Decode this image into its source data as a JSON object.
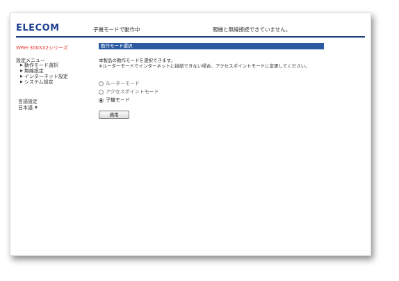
{
  "header": {
    "logo": "ELECOM",
    "status_mode": "子機モードで動作中",
    "status_link": "親機と無線接続できていません。"
  },
  "sidebar": {
    "model": "WRH-300XX2シリーズ",
    "menu_title": "設定メニュー",
    "items": [
      {
        "label": "動作モード選択"
      },
      {
        "label": "無線設定"
      },
      {
        "label": "インターネット設定"
      },
      {
        "label": "システム設定"
      }
    ],
    "language_label": "言語設定",
    "language_value": "日本語"
  },
  "main": {
    "section_title": "動作モード選択",
    "description_1": "本製品の動作モードを選択できます。",
    "description_2": "※ルーターモードでインターネットに接続できない場合、アクセスポイントモードに変更してください。",
    "modes": [
      {
        "label": "ルーターモード",
        "selected": false
      },
      {
        "label": "アクセスポイントモード",
        "selected": false
      },
      {
        "label": "子機モード",
        "selected": true
      }
    ],
    "apply_label": "適用"
  }
}
